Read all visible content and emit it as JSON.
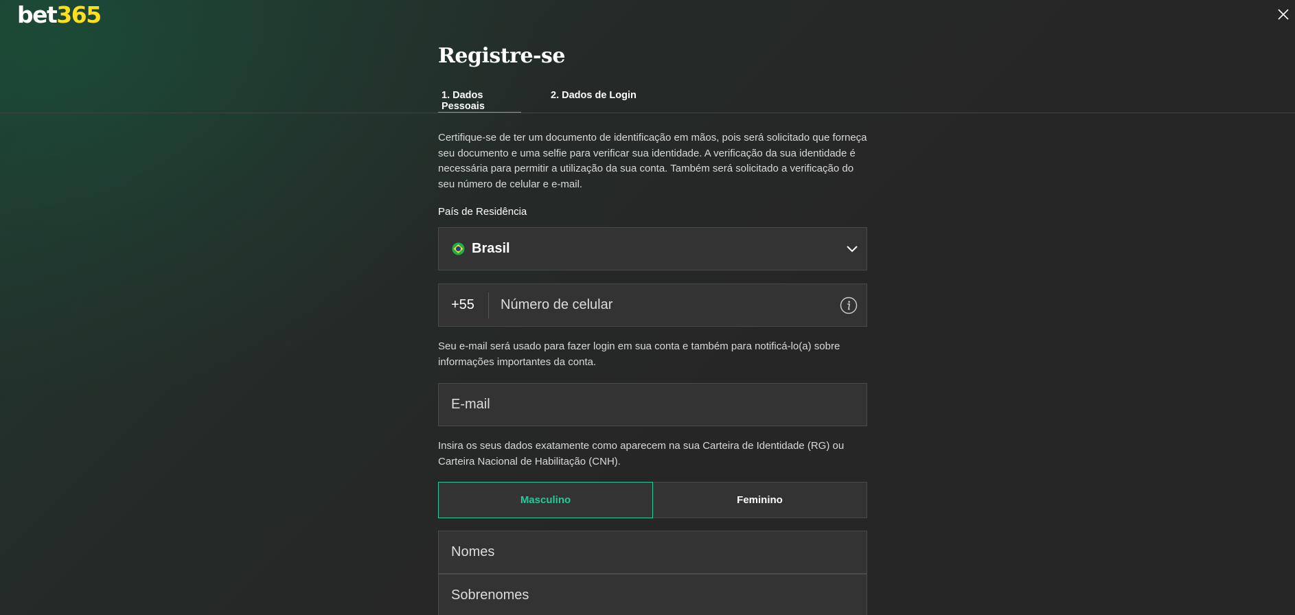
{
  "brand": {
    "logo_part1": "bet",
    "logo_part2": "365"
  },
  "page": {
    "title": "Registre-se"
  },
  "tabs": [
    {
      "label": "1. Dados Pessoais",
      "active": true
    },
    {
      "label": "2. Dados de Login",
      "active": false
    }
  ],
  "intro_text": "Certifique-se de ter um documento de identificação em mãos, pois será solicitado que forneça seu documento e uma selfie para verificar sua identidade. A verificação da sua identidade é necessária para permitir a utilização da sua conta. Também será solicitado a verificação do seu número de celular e e-mail.",
  "country": {
    "label": "País de Residência",
    "value": "Brasil",
    "flag_icon": "brazil-flag-icon"
  },
  "phone": {
    "prefix": "+55",
    "placeholder": "Número de celular"
  },
  "email_note": "Seu e-mail será usado para fazer login em sua conta e também para notificá-lo(a) sobre informações importantes da conta.",
  "email": {
    "placeholder": "E-mail"
  },
  "id_note": "Insira os seus dados exatamente como aparecem na sua Carteira de Identidade (RG) ou Carteira Nacional de Habilitação (CNH).",
  "gender": {
    "male": "Masculino",
    "female": "Feminino",
    "selected": "Masculino"
  },
  "names": {
    "first_placeholder": "Nomes",
    "last_placeholder": "Sobrenomes"
  },
  "colors": {
    "accent": "#26c99a",
    "logo_yellow": "#ffdf1b",
    "field_bg": "#333333",
    "page_bg": "#262626"
  }
}
